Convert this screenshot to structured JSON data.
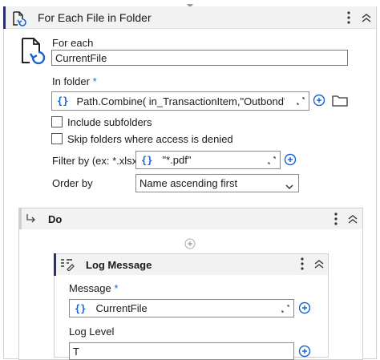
{
  "activity": {
    "title": "For Each File in Folder",
    "for_each_label": "For each",
    "for_each_value": "CurrentFile",
    "in_folder_label": "In folder",
    "required_marker": "*",
    "in_folder_value": "Path.Combine( in_TransactionItem,\"Outbond\")",
    "include_subfolders_label": "Include subfolders",
    "skip_denied_label": "Skip folders where access is denied",
    "filter_label": "Filter by (ex: *.xlsx)",
    "filter_value": "\"*.pdf\"",
    "order_label": "Order by",
    "order_value": "Name ascending first",
    "expr_brace": "{}"
  },
  "do_block": {
    "title": "Do"
  },
  "log_message": {
    "title": "Log Message",
    "message_label": "Message",
    "message_value": "CurrentFile",
    "log_level_label": "Log Level",
    "log_level_value": "T"
  },
  "colors": {
    "accent": "#1464d2",
    "active_bar": "#2a2f6e",
    "header_bg": "#f2f2f2",
    "border": "#d0d0d0"
  }
}
